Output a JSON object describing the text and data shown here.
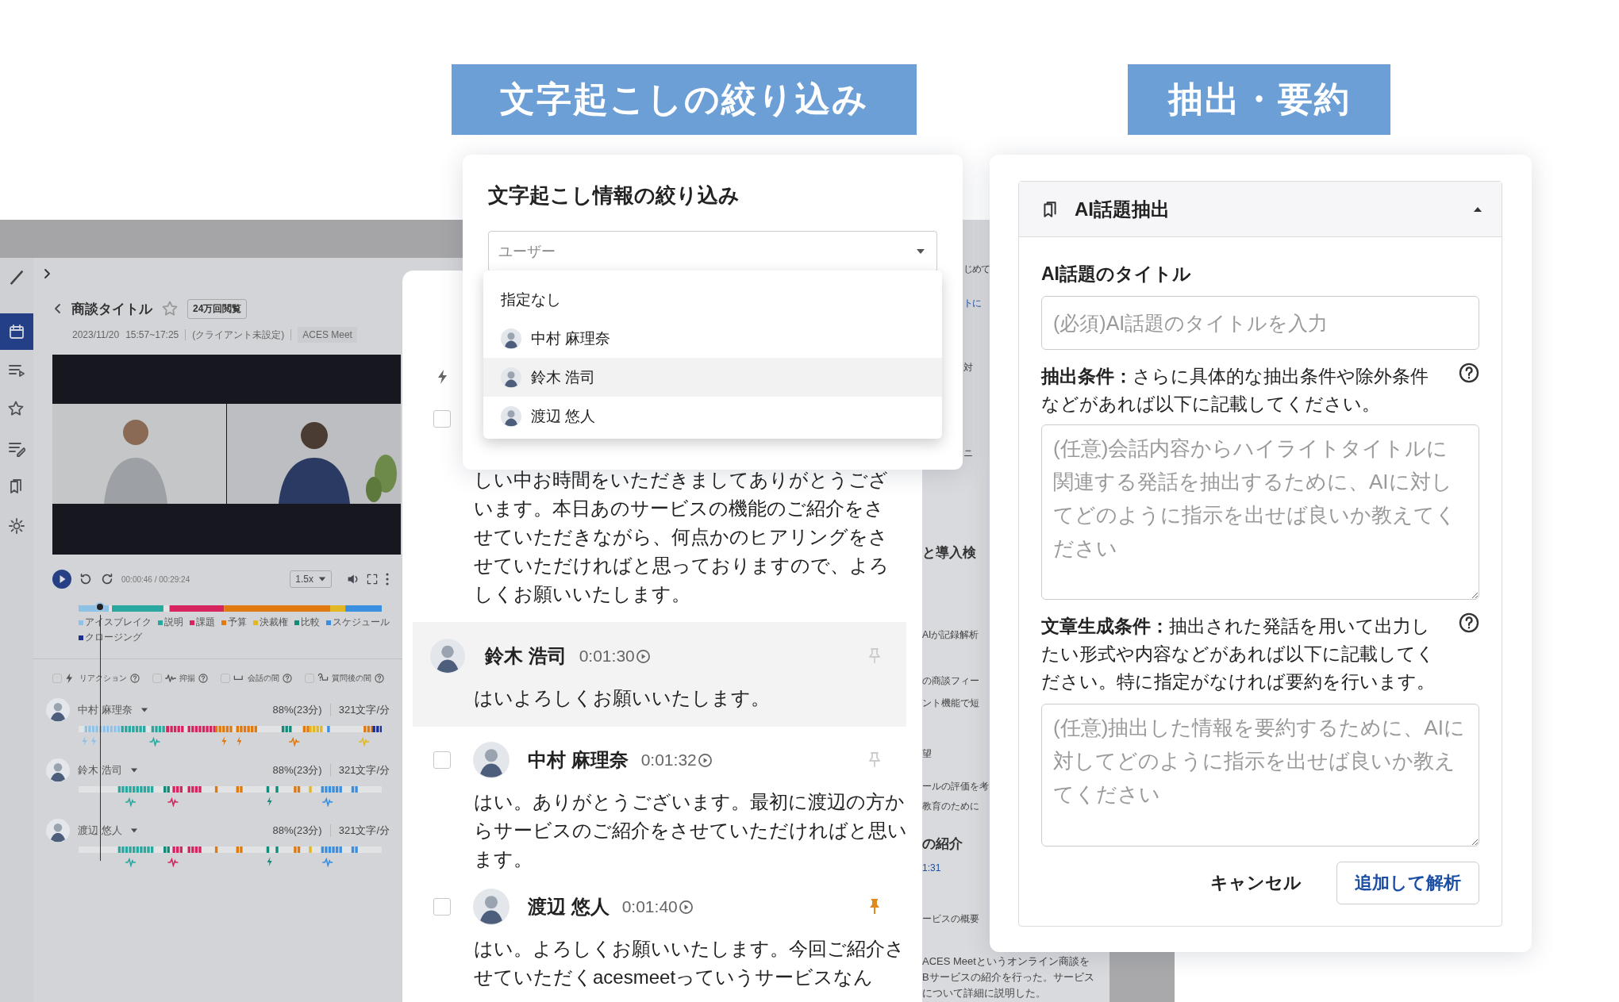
{
  "callouts": [
    "文字起こしの絞り込み",
    "抽出・要約"
  ],
  "app": {
    "sidebar": {
      "items": [
        {
          "selected": true
        },
        {
          "selected": false
        },
        {
          "selected": false
        },
        {
          "selected": false
        },
        {
          "selected": false
        },
        {
          "selected": false
        }
      ]
    },
    "meeting": {
      "title": "商談タイトル",
      "favorite": false,
      "views": "24万回閲覧",
      "date": "2023/11/20",
      "time_range": "15:57~17:25",
      "client": "(クライアント未設定)",
      "tool": "ACES Meet"
    },
    "player": {
      "time": "00:00:46 / 00:29:24",
      "speed": "1.5x",
      "level": 0.07
    },
    "topics": [
      {
        "label": "アイスブレイク",
        "color": "#8fc0e6"
      },
      {
        "label": "説明",
        "color": "#2aa8a0"
      },
      {
        "label": "課題",
        "color": "#d6245f"
      },
      {
        "label": "予算",
        "color": "#e07a10"
      },
      {
        "label": "決裁権",
        "color": "#e3b623"
      },
      {
        "label": "比較",
        "color": "#148a7a"
      },
      {
        "label": "スケジュール",
        "color": "#3b8fe0"
      },
      {
        "label": "クロージング",
        "color": "#1d2f8f"
      }
    ],
    "filters": [
      {
        "label": "リアクション",
        "checked": false
      },
      {
        "label": "抑揚",
        "checked": false
      },
      {
        "label": "会話の間",
        "checked": false
      },
      {
        "label": "質問後の間",
        "checked": false
      }
    ],
    "speakers": [
      {
        "name": "中村 麻理奈",
        "share": "88%(23分)",
        "rate": "321文字/分"
      },
      {
        "name": "鈴木 浩司",
        "share": "88%(23分)",
        "rate": "321文字/分"
      },
      {
        "name": "渡辺 悠人",
        "share": "88%(23分)",
        "rate": "321文字/分"
      }
    ],
    "side_fragments": [
      {
        "text": "じめて",
        "kind": "plain"
      },
      {
        "text": "トに",
        "kind": "link"
      },
      {
        "text": "対",
        "kind": "plain"
      },
      {
        "text": "ニ",
        "kind": "plain"
      },
      {
        "text": "と導入検",
        "kind": "heading"
      },
      {
        "text": "AIが記録解析",
        "kind": "plain"
      },
      {
        "text": "の商談フィー",
        "kind": "plain"
      },
      {
        "text": "ント機能で短",
        "kind": "plain"
      },
      {
        "text": "望",
        "kind": "plain"
      },
      {
        "text": "ールの評価を考",
        "kind": "plain"
      },
      {
        "text": "教育のために",
        "kind": "plain"
      },
      {
        "text": "の紹介",
        "kind": "heading"
      },
      {
        "text": "1:31",
        "kind": "link"
      },
      {
        "text": "ービスの概要",
        "kind": "plain"
      }
    ],
    "summary_lines": [
      "ACES Meetというオンライン商談を",
      "Bサービスの紹介を行った。サービス",
      "について詳細に説明した。"
    ]
  },
  "transcript": {
    "checkbox": {
      "checked": false
    },
    "paragraph": "しい中お時間をいただきましてありがとうございます。本日あのサービスの機能のご紹介をさせていただきながら、何点かのヒアリングをさせていただければと思っておりますので、よろしくお願いいたします。",
    "entries": [
      {
        "name": "鈴木 浩司",
        "time": "0:01:30",
        "text": "はいよろしくお願いいたします。",
        "pinned": false,
        "selected": true
      },
      {
        "name": "中村 麻理奈",
        "time": "0:01:32",
        "text": "はい。ありがとうございます。最初に渡辺の方からサービスのご紹介をさせていただければと思います。",
        "pinned": false,
        "selected": false,
        "checked": false
      },
      {
        "name": "渡辺 悠人",
        "time": "0:01:40",
        "text": "はい。よろしくお願いいたします。今回ご紹介させていただくacesmeetっていうサービスなん",
        "pinned": true,
        "selected": false,
        "checked": false
      }
    ]
  },
  "filter_dialog": {
    "title": "文字起こし情報の絞り込み",
    "select": {
      "placeholder": "ユーザー"
    },
    "options": [
      {
        "label": "指定なし",
        "kind": "none",
        "selected": false
      },
      {
        "label": "中村 麻理奈",
        "kind": "user",
        "selected": false
      },
      {
        "label": "鈴木 浩司",
        "kind": "user",
        "selected": true
      },
      {
        "label": "渡辺 悠人",
        "kind": "user",
        "selected": false
      }
    ]
  },
  "extract_panel": {
    "title": "AI話題抽出",
    "expanded": true,
    "title_field": {
      "label": "AI話題のタイトル",
      "placeholder": "(必須)AI話題のタイトルを入力"
    },
    "conditions": [
      {
        "text": "**抽出条件：**さらに具体的な抽出条件や除外条件などがあれば以下に記載してください。",
        "placeholder": "(任意)会話内容からハイライトタイトルに関連する発話を抽出するために、AIに対してどのように指示を出せば良いか教えてください"
      },
      {
        "text": "**文章生成条件：**抽出された発話を用いて出力したい形式や内容などがあれば以下に記載してください。特に指定がなければ要約を行います。",
        "placeholder": "(任意)抽出した情報を要約するために、AIに対してどのように指示を出せば良いか教えてください"
      }
    ],
    "buttons": [
      {
        "label": "キャンセル",
        "kind": "text"
      },
      {
        "label": "追加して解析",
        "kind": "outlined"
      }
    ]
  }
}
